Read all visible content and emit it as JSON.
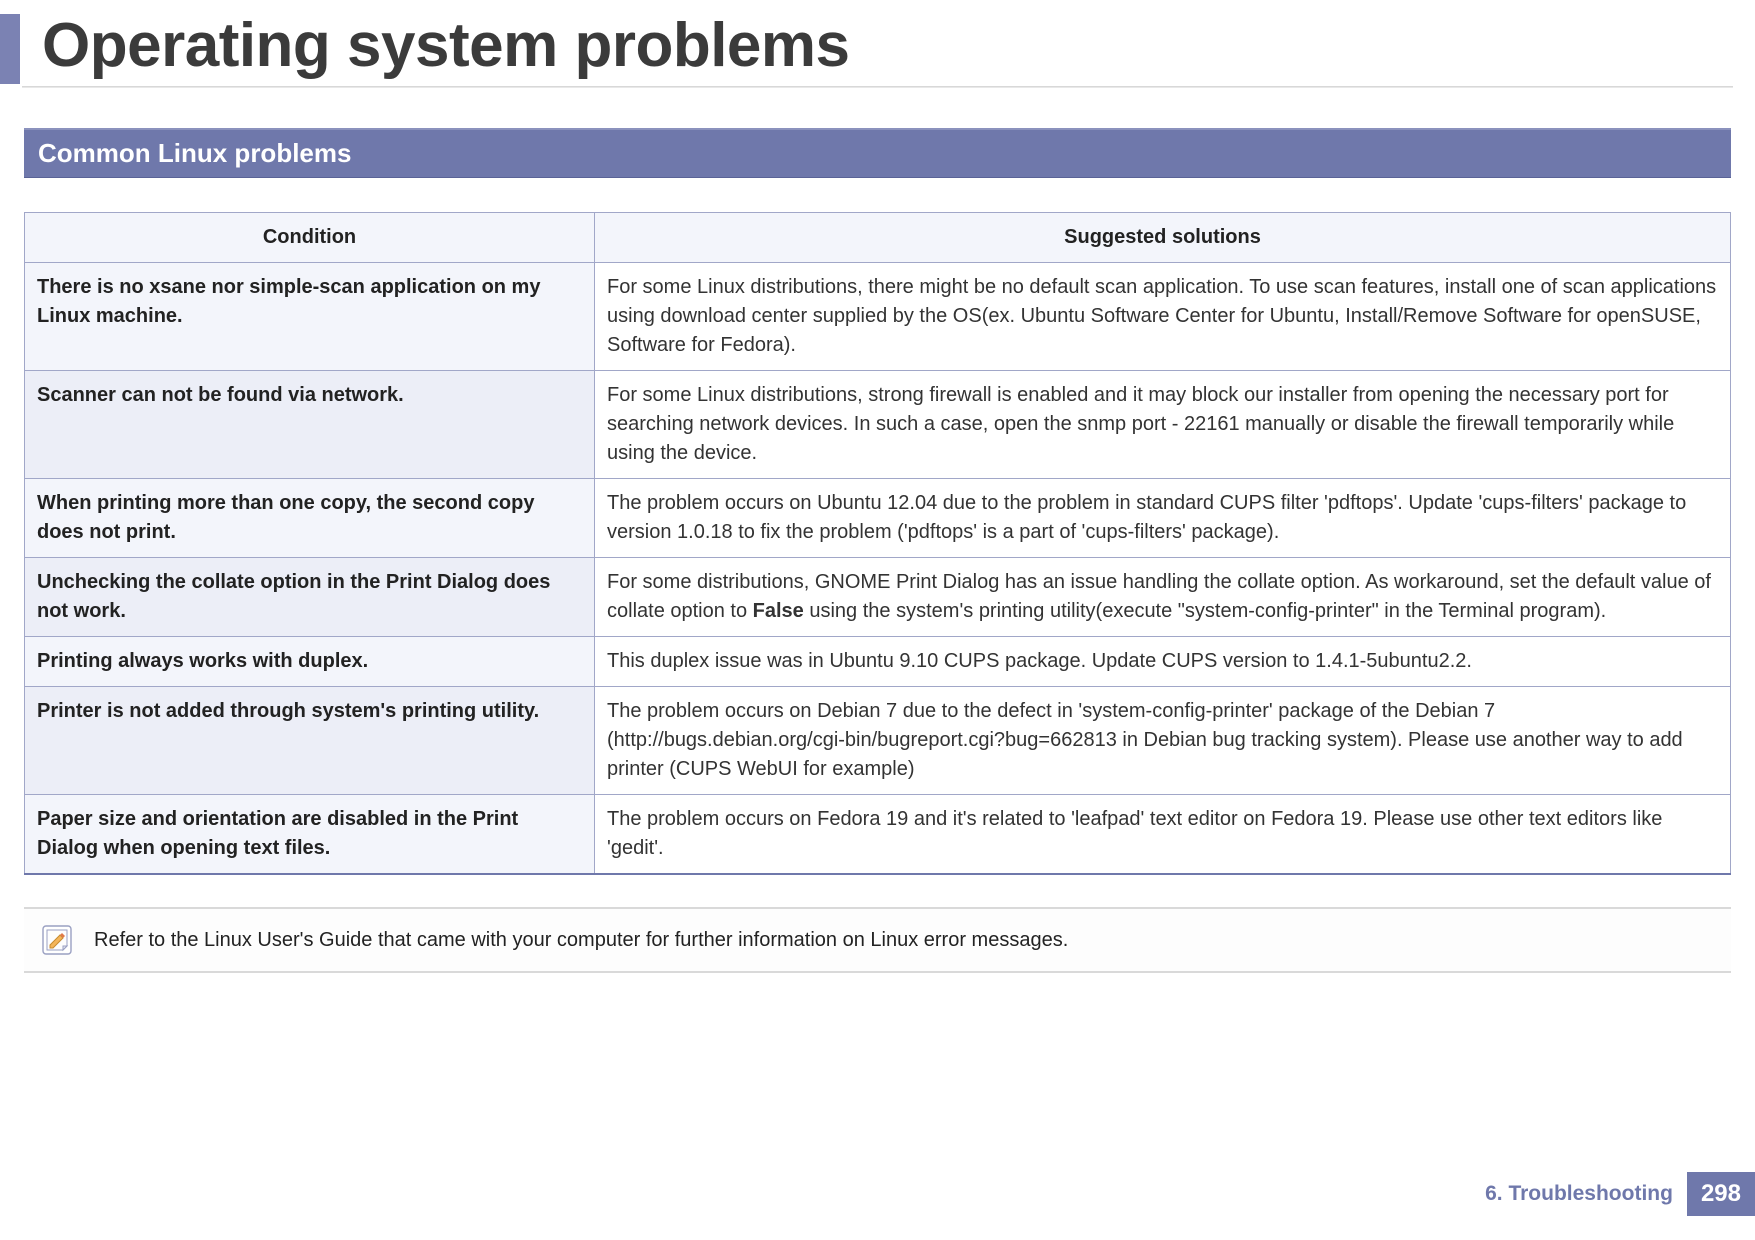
{
  "page_title": "Operating system problems",
  "section_header": "Common Linux problems",
  "table": {
    "headers": [
      "Condition",
      "Suggested solutions"
    ],
    "rows": [
      {
        "condition": "There is no xsane nor simple-scan application on my Linux machine.",
        "solution": "For some Linux distributions, there might be no default scan application. To use scan features, install one of scan applications using download center supplied by the OS(ex. Ubuntu Software Center for Ubuntu, Install/Remove Software for openSUSE, Software for Fedora)."
      },
      {
        "condition": "Scanner can not be found via network.",
        "solution": "For some Linux distributions, strong firewall is enabled and it may block our installer from opening the necessary port for searching network devices. In such a case, open the snmp port - 22161 manually or disable the firewall temporarily while using the device."
      },
      {
        "condition": "When printing more than one copy, the second copy does not print.",
        "solution": "The problem occurs on Ubuntu 12.04 due to the problem in standard CUPS filter 'pdftops'. Update 'cups-filters' package to version 1.0.18 to fix the problem ('pdftops' is a part of 'cups-filters' package)."
      },
      {
        "condition": "Unchecking the collate option in the Print Dialog does not work.",
        "solution_pre": "For some distributions, GNOME Print Dialog has an issue handling the collate option. As workaround, set the default value of collate option to ",
        "solution_bold": "False",
        "solution_post": " using the system's printing utility(execute \"system-config-printer\" in the Terminal program)."
      },
      {
        "condition": "Printing always works with duplex.",
        "solution": "This duplex issue was in Ubuntu 9.10 CUPS package. Update CUPS version to 1.4.1-5ubuntu2.2."
      },
      {
        "condition": "Printer is not added through system's printing utility.",
        "solution": "The problem occurs on Debian 7 due to the defect in 'system-config-printer' package of the Debian 7 (http://bugs.debian.org/cgi-bin/bugreport.cgi?bug=662813 in Debian bug tracking system). Please use another way to add printer (CUPS WebUI for example)"
      },
      {
        "condition": "Paper size and orientation are disabled in the Print Dialog when opening text files.",
        "solution": "The problem occurs on Fedora 19 and it's related to 'leafpad' text editor on Fedora 19. Please use other text editors like 'gedit'."
      }
    ]
  },
  "note_text": "Refer to the Linux User's Guide that came with your computer for further information on Linux error messages.",
  "footer": {
    "chapter": "6.  Troubleshooting",
    "page": "298"
  }
}
